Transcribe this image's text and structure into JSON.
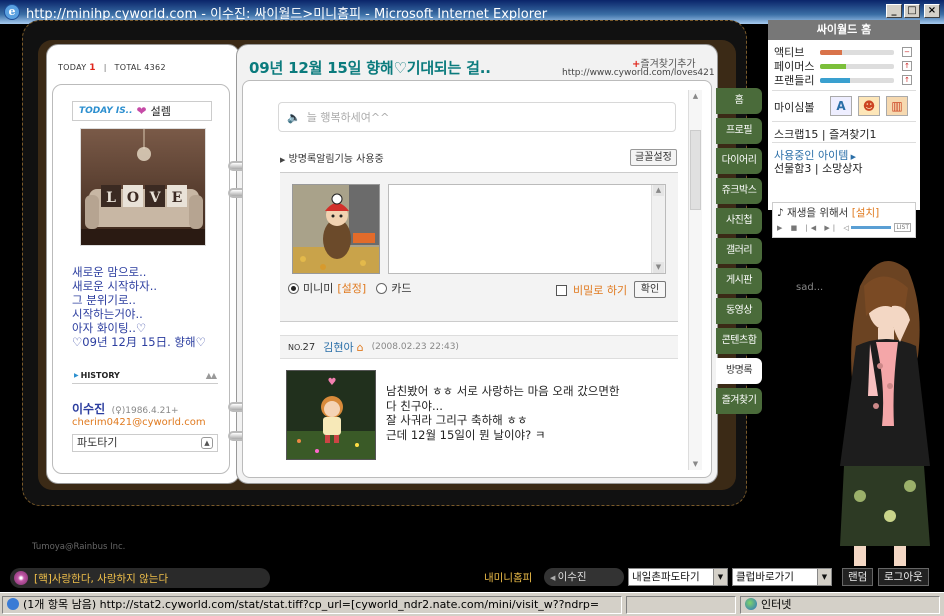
{
  "window": {
    "title": "http://minihp.cyworld.com - 이수진: 싸이월드>미니홈피 - Microsoft Internet Explorer",
    "minimize": "_",
    "maximize": "□",
    "close": "×"
  },
  "left": {
    "today_label": "TODAY",
    "today_count": "1",
    "total_label": "TOTAL",
    "total_count": "4362",
    "today_is_label": "TODAY IS..",
    "mood": "설렘",
    "intro_lines": [
      "새로운 맘으로..",
      "새로운 시작하자..",
      "그 분위기로..",
      "시작하는거야..",
      "아자 화이팅..♡",
      "♡09년 12月 15日. 향해♡"
    ],
    "history_label": "HISTORY",
    "name": "이수진",
    "gender_birth": "(♀)1986.4.21+",
    "email": "cherim0421@cyworld.com",
    "pado": "파도타기"
  },
  "right": {
    "headline": "09년 12월 15일 향해♡기대되는 걸..",
    "fav_label": "즐겨찾기추가",
    "url": "http://www.cyworld.com/loves421",
    "message": "늘 행복하세여^^",
    "guest_notice": "방명록알림기능 사용중",
    "font_btn": "글꼴설정",
    "radio_minimi": "미니미",
    "radio_set": "[설정]",
    "radio_card": "카드",
    "secret_label": "비밀로 하기",
    "ok_btn": "확인",
    "entry": {
      "no_label": "NO.",
      "no": "27",
      "writer": "김현아",
      "date": "(2008.02.23 22:43)",
      "lines": [
        "남친봤어 ㅎㅎ 서로 사랑하는 마음 오래 갔으면한",
        "다 친구야...",
        "잘 사궈라 그리구 축하해 ㅎㅎ",
        "근데 12월 15일이 뭔 날이야? ㅋ"
      ]
    }
  },
  "tabs": [
    "홈",
    "프로필",
    "다이어리",
    "쥬크박스",
    "사진첩",
    "갤러리",
    "게시판",
    "동영상",
    "콘텐츠함",
    "방명록",
    "즐겨찾기"
  ],
  "active_tab": "방명록",
  "cyworld_panel": {
    "title": "싸이월드 홈",
    "stats": [
      {
        "label": "액티브",
        "level": 0.3,
        "color": "#d9734a"
      },
      {
        "label": "페이머스",
        "level": 0.35,
        "color": "#7bbf3a"
      },
      {
        "label": "프랜들리",
        "level": 0.4,
        "color": "#3aa0cf"
      }
    ],
    "mysim_label": "마이심볼",
    "scrap": "스크랩15",
    "fav_count": "즐겨찾기1",
    "items_link": "사용중인 아이템",
    "gift": "선물함3",
    "shopping": "소망상자"
  },
  "player": {
    "text": "♪ 재생을 위해서",
    "install": "[설치]",
    "list": "LIST"
  },
  "sad_text": "sad...",
  "credit": "Tumoya@Rainbus Inc.",
  "bottom": {
    "song": "[핵]사랑한다, 사랑하지 않는다",
    "my_mini": "내미니홈피",
    "nav_name": "이수진",
    "pado_select": "내일촌파도타기",
    "club_select": "클럽바로가기",
    "random_btn": "랜덤",
    "logout_btn": "로그아웃"
  },
  "status": {
    "text": "(1개 항목 남음) http://stat2.cyworld.com/stat/stat.tiff?cp_url=[cyworld_ndr2.nate.com/mini/visit_w??ndrp=",
    "zone": "인터넷"
  }
}
